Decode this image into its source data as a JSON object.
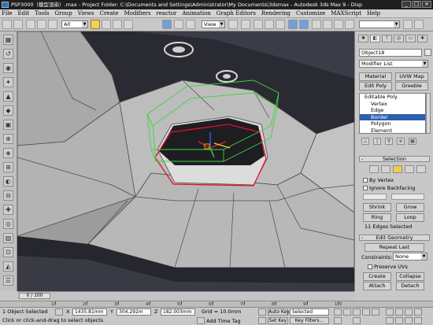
{
  "titlebar": {
    "text": "PSP3000（模型渲染）.max    - Project Folder: C:\\Documents and Settings\\Administrator\\My Documents\\3dsmax    - Autodesk 3ds Max 9    - Disp"
  },
  "menu": [
    "File",
    "Edit",
    "Tools",
    "Group",
    "Views",
    "Create",
    "Modifiers",
    "reactor",
    "Animation",
    "Graph Editors",
    "Rendering",
    "Customize",
    "MAXScript",
    "Help"
  ],
  "toolbar": {
    "filter_value": "All",
    "coord_value": "View"
  },
  "command_panel": {
    "object_name": "Object18",
    "modifier_list": "Modifier List",
    "buttons_row1": [
      "Material",
      "UVW Map"
    ],
    "buttons_row2": [
      "Edit Poly",
      "Greeble"
    ],
    "stack": [
      "Editable Poly",
      "Vertex",
      "Edge",
      "Border",
      "Polygon",
      "Element"
    ],
    "selection_title": "Selection",
    "by_vertex": "By Vertex",
    "ignore_backfacing": "Ignore Backfacing",
    "shrink": "Shrink",
    "grow": "Grow",
    "ring": "Ring",
    "loop": "Loop",
    "selected_info": "11 Edges Selected",
    "edit_geometry_title": "Edit Geometry",
    "repeat_last": "Repeat Last",
    "constraints_label": "Constraints:",
    "constraints_value": "None",
    "preserve_uvs": "Preserve UVs",
    "create": "Create",
    "collapse": "Collapse",
    "attach": "Attach",
    "detach": "Detach",
    "slice_plane": "Slice Plane",
    "split": "Split"
  },
  "timeline": {
    "slider_text": "0 / 100",
    "ticks": [
      "10",
      "20",
      "30",
      "40",
      "50",
      "60",
      "70",
      "80",
      "90",
      "100"
    ]
  },
  "status": {
    "objects_selected": "1 Object Selected",
    "prompt": "Click or click-and-drag to select objects",
    "x_label": "X",
    "x_value": "1435.81mm",
    "y_label": "Y",
    "y_value": "304.292m",
    "z_label": "Z",
    "z_value": "182.003mm",
    "grid": "Grid = 10.0mm",
    "add_time_tag": "Add Time Tag",
    "auto_key": "Auto Key",
    "selected_dd": "Selected",
    "set_key": "Set Key",
    "key_filters": "Key Filters..."
  },
  "colors": {
    "selection_red": "#e0102a",
    "gizmo_green": "#3fd23f",
    "active_yellow": "#f0cc4e",
    "stack_highlight": "#2d5fb0"
  }
}
